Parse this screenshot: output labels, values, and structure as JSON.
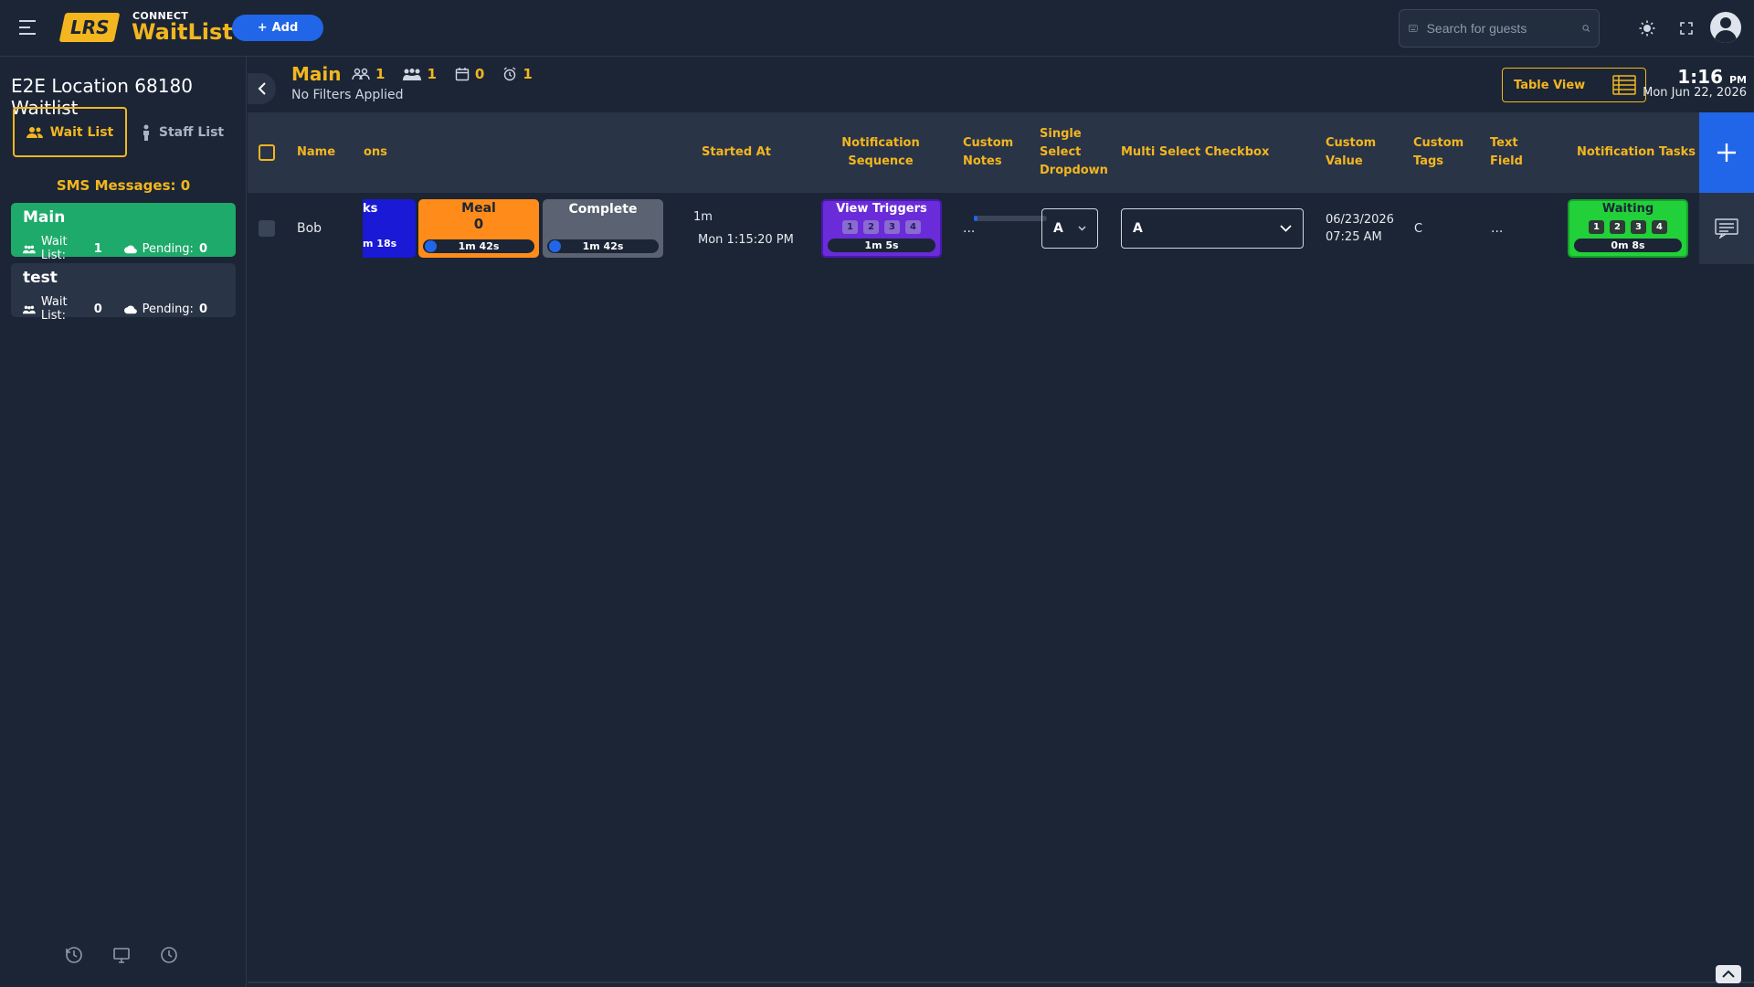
{
  "app": {
    "brand_small": "CONNECT",
    "brand_big": "WaitList",
    "logo_text": "LRS",
    "add_label": "Add",
    "search_placeholder": "Search for guests"
  },
  "sidebar": {
    "location_title": "E2E Location 68180 Waitlist",
    "tabs": [
      {
        "label": "Wait List",
        "active": true
      },
      {
        "label": "Staff List",
        "active": false
      }
    ],
    "sms_messages": "SMS Messages: 0",
    "lists": [
      {
        "name": "Main",
        "wait_label": "Wait List:",
        "wait_count": "1",
        "pending_label": "Pending:",
        "pending_count": "0",
        "color": "#1eaa6a"
      },
      {
        "name": "test",
        "wait_label": "Wait List:",
        "wait_count": "0",
        "pending_label": "Pending:",
        "pending_count": "0",
        "color": "#2a3447"
      }
    ]
  },
  "header": {
    "title": "Main",
    "stats": {
      "guests": "1",
      "parties": "1",
      "reservations": "0",
      "alarms": "1"
    },
    "filters": "No Filters Applied",
    "table_view_label": "Table View",
    "time": "1:16",
    "ampm": "PM",
    "date": "Mon Jun 22, 2026"
  },
  "table": {
    "columns": {
      "name": "Name",
      "statuses": "ons",
      "started_at": "Started At",
      "notification_sequence": "Notification Sequence",
      "custom_notes": "Custom Notes",
      "single_select": "Single Select Dropdown",
      "multi_select": "Multi Select Checkbox",
      "custom_value": "Custom Value",
      "custom_tags": "Custom Tags",
      "text_field": "Text Field",
      "notification_tasks": "Notification Tasks"
    },
    "row": {
      "name": "Bob",
      "partial_status_top": "ks",
      "partial_status_time": "m 18s",
      "meal_title": "Meal",
      "meal_count": "0",
      "meal_time": "1m 42s",
      "complete_title": "Complete",
      "complete_time": "1m 42s",
      "started_elapsed": "1m",
      "started_progress": 0.05,
      "started_at": "Mon 1:15:20 PM",
      "notification_title": "View Triggers",
      "notification_nums": [
        "1",
        "2",
        "3",
        "4"
      ],
      "notification_time": "1m 5s",
      "custom_notes": "...",
      "single_select_value": "A",
      "multi_select_value": "A",
      "custom_value_date": "06/23/2026",
      "custom_value_time": "07:25 AM",
      "custom_tags": "C",
      "text_field": "...",
      "task_title": "Waiting",
      "task_nums": [
        "1",
        "2",
        "3",
        "4"
      ],
      "task_time": "0m 8s"
    }
  },
  "colors": {
    "accent": "#f3b61f",
    "primary_blue": "#2166e8",
    "green": "#1eaa6a",
    "meal_orange": "#ff8c1a",
    "complete_gray": "#5b6271",
    "notif_purple": "#6a2bd9",
    "waiting_green": "#22d03a"
  }
}
